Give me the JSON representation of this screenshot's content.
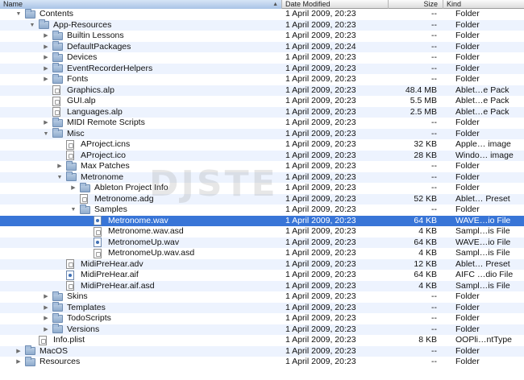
{
  "columns": {
    "name": "Name",
    "date": "Date Modified",
    "size": "Size",
    "kind": "Kind"
  },
  "rows": [
    {
      "name": "Contents",
      "depth": 0,
      "exp": "open",
      "icon": "folder",
      "date": "1 April 2009, 20:23",
      "size": "--",
      "kind": "Folder"
    },
    {
      "name": "App-Resources",
      "depth": 1,
      "exp": "open",
      "icon": "folder",
      "date": "1 April 2009, 20:23",
      "size": "--",
      "kind": "Folder"
    },
    {
      "name": "Builtin Lessons",
      "depth": 2,
      "exp": "closed",
      "icon": "folder",
      "date": "1 April 2009, 20:23",
      "size": "--",
      "kind": "Folder"
    },
    {
      "name": "DefaultPackages",
      "depth": 2,
      "exp": "closed",
      "icon": "folder",
      "date": "1 April 2009, 20:24",
      "size": "--",
      "kind": "Folder"
    },
    {
      "name": "Devices",
      "depth": 2,
      "exp": "closed",
      "icon": "folder",
      "date": "1 April 2009, 20:23",
      "size": "--",
      "kind": "Folder"
    },
    {
      "name": "EventRecorderHelpers",
      "depth": 2,
      "exp": "closed",
      "icon": "folder",
      "date": "1 April 2009, 20:23",
      "size": "--",
      "kind": "Folder"
    },
    {
      "name": "Fonts",
      "depth": 2,
      "exp": "closed",
      "icon": "folder",
      "date": "1 April 2009, 20:23",
      "size": "--",
      "kind": "Folder"
    },
    {
      "name": "Graphics.alp",
      "depth": 2,
      "exp": "none",
      "icon": "file",
      "date": "1 April 2009, 20:23",
      "size": "48.4 MB",
      "kind": "Ablet…e Pack"
    },
    {
      "name": "GUI.alp",
      "depth": 2,
      "exp": "none",
      "icon": "file",
      "date": "1 April 2009, 20:23",
      "size": "5.5 MB",
      "kind": "Ablet…e Pack"
    },
    {
      "name": "Languages.alp",
      "depth": 2,
      "exp": "none",
      "icon": "file",
      "date": "1 April 2009, 20:23",
      "size": "2.5 MB",
      "kind": "Ablet…e Pack"
    },
    {
      "name": "MIDI Remote Scripts",
      "depth": 2,
      "exp": "closed",
      "icon": "folder",
      "date": "1 April 2009, 20:23",
      "size": "--",
      "kind": "Folder"
    },
    {
      "name": "Misc",
      "depth": 2,
      "exp": "open",
      "icon": "folder",
      "date": "1 April 2009, 20:23",
      "size": "--",
      "kind": "Folder"
    },
    {
      "name": "AProject.icns",
      "depth": 3,
      "exp": "none",
      "icon": "file",
      "date": "1 April 2009, 20:23",
      "size": "32 KB",
      "kind": "Apple… image"
    },
    {
      "name": "AProject.ico",
      "depth": 3,
      "exp": "none",
      "icon": "file",
      "date": "1 April 2009, 20:23",
      "size": "28 KB",
      "kind": "Windo… image"
    },
    {
      "name": "Max Patches",
      "depth": 3,
      "exp": "closed",
      "icon": "folder",
      "date": "1 April 2009, 20:23",
      "size": "--",
      "kind": "Folder"
    },
    {
      "name": "Metronome",
      "depth": 3,
      "exp": "open",
      "icon": "folder",
      "date": "1 April 2009, 20:23",
      "size": "--",
      "kind": "Folder"
    },
    {
      "name": "Ableton Project Info",
      "depth": 4,
      "exp": "closed",
      "icon": "folder",
      "date": "1 April 2009, 20:23",
      "size": "--",
      "kind": "Folder"
    },
    {
      "name": "Metronome.adg",
      "depth": 4,
      "exp": "none",
      "icon": "file",
      "date": "1 April 2009, 20:23",
      "size": "52 KB",
      "kind": "Ablet… Preset"
    },
    {
      "name": "Samples",
      "depth": 4,
      "exp": "open",
      "icon": "folder",
      "date": "1 April 2009, 20:23",
      "size": "--",
      "kind": "Folder"
    },
    {
      "name": "Metronome.wav",
      "depth": 5,
      "exp": "none",
      "icon": "audio",
      "date": "1 April 2009, 20:23",
      "size": "64 KB",
      "kind": "WAVE…io File",
      "selected": true
    },
    {
      "name": "Metronome.wav.asd",
      "depth": 5,
      "exp": "none",
      "icon": "file",
      "date": "1 April 2009, 20:23",
      "size": "4 KB",
      "kind": "Sampl…is File"
    },
    {
      "name": "MetronomeUp.wav",
      "depth": 5,
      "exp": "none",
      "icon": "audio",
      "date": "1 April 2009, 20:23",
      "size": "64 KB",
      "kind": "WAVE…io File"
    },
    {
      "name": "MetronomeUp.wav.asd",
      "depth": 5,
      "exp": "none",
      "icon": "file",
      "date": "1 April 2009, 20:23",
      "size": "4 KB",
      "kind": "Sampl…is File"
    },
    {
      "name": "MidiPreHear.adv",
      "depth": 3,
      "exp": "none",
      "icon": "file",
      "date": "1 April 2009, 20:23",
      "size": "12 KB",
      "kind": "Ablet… Preset"
    },
    {
      "name": "MidiPreHear.aif",
      "depth": 3,
      "exp": "none",
      "icon": "audio",
      "date": "1 April 2009, 20:23",
      "size": "64 KB",
      "kind": "AIFC …dio File"
    },
    {
      "name": "MidiPreHear.aif.asd",
      "depth": 3,
      "exp": "none",
      "icon": "file",
      "date": "1 April 2009, 20:23",
      "size": "4 KB",
      "kind": "Sampl…is File"
    },
    {
      "name": "Skins",
      "depth": 2,
      "exp": "closed",
      "icon": "folder",
      "date": "1 April 2009, 20:23",
      "size": "--",
      "kind": "Folder"
    },
    {
      "name": "Templates",
      "depth": 2,
      "exp": "closed",
      "icon": "folder",
      "date": "1 April 2009, 20:23",
      "size": "--",
      "kind": "Folder"
    },
    {
      "name": "TodoScripts",
      "depth": 2,
      "exp": "closed",
      "icon": "folder",
      "date": "1 April 2009, 20:23",
      "size": "--",
      "kind": "Folder"
    },
    {
      "name": "Versions",
      "depth": 2,
      "exp": "closed",
      "icon": "folder",
      "date": "1 April 2009, 20:23",
      "size": "--",
      "kind": "Folder"
    },
    {
      "name": "Info.plist",
      "depth": 1,
      "exp": "none",
      "icon": "file",
      "date": "1 April 2009, 20:23",
      "size": "8 KB",
      "kind": "OOPli…ntType"
    },
    {
      "name": "MacOS",
      "depth": 0,
      "exp": "closed",
      "icon": "folder",
      "date": "1 April 2009, 20:23",
      "size": "--",
      "kind": "Folder"
    },
    {
      "name": "Resources",
      "depth": 0,
      "exp": "closed",
      "icon": "folder",
      "date": "1 April 2009, 20:23",
      "size": "--",
      "kind": "Folder"
    }
  ],
  "watermark": "DJSTE",
  "colors": {
    "selection": "#3875d7",
    "stripe": "#edf3fe",
    "folder": "#8fabcd"
  }
}
